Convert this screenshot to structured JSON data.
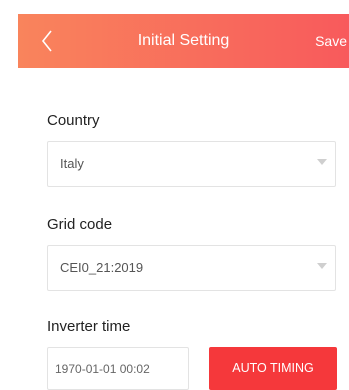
{
  "header": {
    "title": "Initial Setting",
    "save_label": "Save",
    "back_icon": "chevron-left-icon"
  },
  "form": {
    "country": {
      "label": "Country",
      "value": "Italy"
    },
    "grid_code": {
      "label": "Grid code",
      "value": "CEI0_21:2019"
    },
    "inverter_time": {
      "label": "Inverter time",
      "value": "1970-01-01 00:02",
      "button_label": "AUTO TIMING"
    }
  },
  "colors": {
    "header_start": "#f9845c",
    "header_end": "#f85a5c",
    "button": "#f5383b"
  }
}
